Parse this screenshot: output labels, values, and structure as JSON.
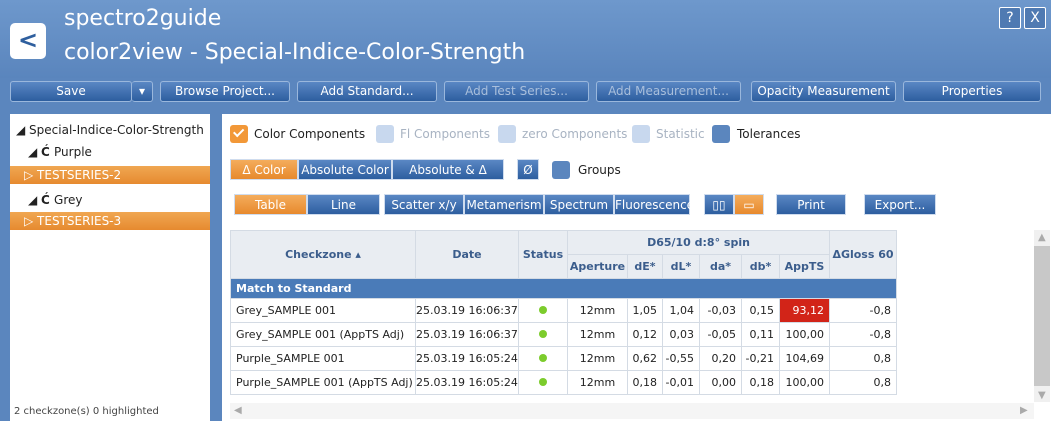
{
  "app": {
    "title": "spectro2guide",
    "subtitle": "color2view - Special-Indice-Color-Strength",
    "help": "?",
    "close": "X",
    "back": "<"
  },
  "toolbar": {
    "save": "Save",
    "dropdown": "▾",
    "browse": "Browse Project...",
    "add_standard": "Add Standard...",
    "add_test_series": "Add Test Series...",
    "add_measurement": "Add Measurement...",
    "opacity": "Opacity Measurement",
    "properties": "Properties"
  },
  "tree": {
    "root": "Special-Indice-Color-Strength",
    "purple": "Purple",
    "testseries2": "TESTSERIES-2",
    "grey": "Grey",
    "testseries3": "TESTSERIES-3",
    "footer": "2 checkzone(s) 0 highlighted"
  },
  "options": {
    "color_components": "Color Components",
    "fl_components": "Fl Components",
    "zero_components": "zero Components",
    "statistic": "Statistic",
    "tolerances": "Tolerances",
    "delta_color": "Δ Color",
    "absolute_color": "Absolute Color",
    "absolute_delta": "Absolute & Δ Color",
    "avg": "Ø",
    "groups": "Groups"
  },
  "views": {
    "table": "Table",
    "line": "Line",
    "scatter": "Scatter x/y",
    "metamerism": "Metamerism",
    "spectrum": "Spectrum",
    "fluorescence": "Fluorescence",
    "print": "Print",
    "export": "Export..."
  },
  "table": {
    "h_checkzone": "Checkzone ▴",
    "h_date": "Date",
    "h_status": "Status",
    "h_illum": "D65/10  d:8° spin",
    "h_aperture": "Aperture",
    "h_de": "dE*",
    "h_dl": "dL*",
    "h_da": "da*",
    "h_db": "db*",
    "h_appts": "AppTS",
    "h_gloss": "ΔGloss 60",
    "group": "Match to Standard",
    "rows": [
      {
        "name": "Grey_SAMPLE 001",
        "date": "25.03.19 16:06:37",
        "aperture": "12mm",
        "de": "1,05",
        "dl": "1,04",
        "da": "-0,03",
        "db": "0,15",
        "appts": "93,12",
        "gloss": "-0,8"
      },
      {
        "name": "Grey_SAMPLE 001 (AppTS Adj)",
        "date": "25.03.19 16:06:37",
        "aperture": "12mm",
        "de": "0,12",
        "dl": "0,03",
        "da": "-0,05",
        "db": "0,11",
        "appts": "100,00",
        "gloss": "-0,8"
      },
      {
        "name": "Purple_SAMPLE 001",
        "date": "25.03.19 16:05:24",
        "aperture": "12mm",
        "de": "0,62",
        "dl": "-0,55",
        "da": "0,20",
        "db": "-0,21",
        "appts": "104,69",
        "gloss": "0,8"
      },
      {
        "name": "Purple_SAMPLE 001 (AppTS Adj)",
        "date": "25.03.19 16:05:24",
        "aperture": "12mm",
        "de": "0,18",
        "dl": "-0,01",
        "da": "0,00",
        "db": "0,18",
        "appts": "100,00",
        "gloss": "0,8"
      }
    ]
  },
  "colors": {
    "accent": "#f29838",
    "primary": "#5b86be",
    "status_ok": "#7ccc2c",
    "alert": "#d22418"
  }
}
